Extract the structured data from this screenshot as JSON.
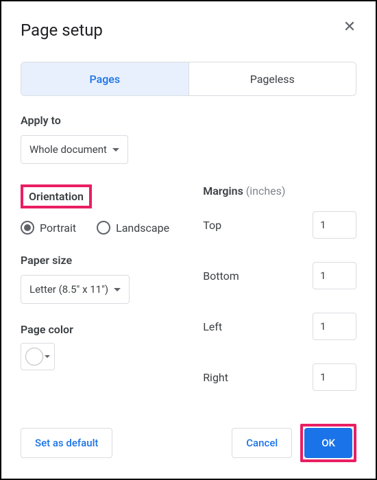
{
  "dialog": {
    "title": "Page setup"
  },
  "tabs": {
    "pages": "Pages",
    "pageless": "Pageless"
  },
  "applyTo": {
    "label": "Apply to",
    "value": "Whole document"
  },
  "orientation": {
    "label": "Orientation",
    "options": {
      "portrait": "Portrait",
      "landscape": "Landscape"
    },
    "selected": "portrait"
  },
  "paperSize": {
    "label": "Paper size",
    "value": "Letter (8.5\" x 11\")"
  },
  "pageColor": {
    "label": "Page color"
  },
  "margins": {
    "label": "Margins",
    "unit": "(inches)",
    "top": {
      "label": "Top",
      "value": "1"
    },
    "bottom": {
      "label": "Bottom",
      "value": "1"
    },
    "left": {
      "label": "Left",
      "value": "1"
    },
    "right": {
      "label": "Right",
      "value": "1"
    }
  },
  "footer": {
    "setDefault": "Set as default",
    "cancel": "Cancel",
    "ok": "OK"
  }
}
